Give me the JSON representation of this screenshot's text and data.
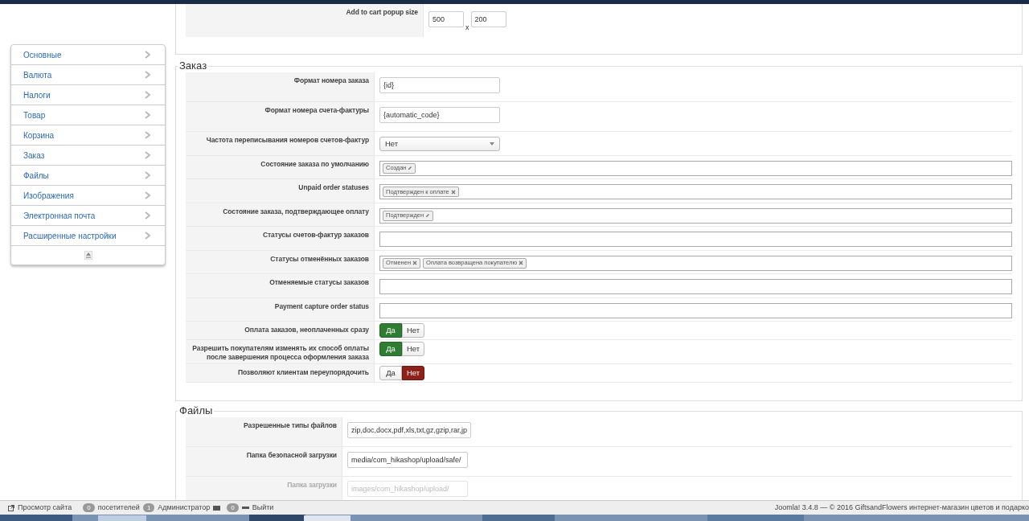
{
  "top_section": {
    "rows": [
      {
        "label": "Add to cart popup size",
        "kind": "size",
        "values": [
          "500",
          "200"
        ],
        "separator": "x"
      }
    ]
  },
  "sidebar": {
    "items": [
      {
        "label": "Основные"
      },
      {
        "label": "Валюта"
      },
      {
        "label": "Налоги"
      },
      {
        "label": "Товар"
      },
      {
        "label": "Корзина"
      },
      {
        "label": "Заказ"
      },
      {
        "label": "Файлы"
      },
      {
        "label": "Изображения"
      },
      {
        "label": "Электронная почта"
      },
      {
        "label": "Расширенные настройки"
      }
    ]
  },
  "sections": [
    {
      "title": "Заказ",
      "rows": [
        {
          "label": "Формат номера заказа",
          "kind": "text",
          "value": "{id}"
        },
        {
          "label": "Формат номера счета-фактуры",
          "kind": "text",
          "value": "{automatic_code}"
        },
        {
          "label": "Частота переписывания номеров счетов-фактур",
          "kind": "select",
          "value": "Нет"
        },
        {
          "label": "Состояние заказа по умолчанию",
          "kind": "tags",
          "tags": [
            {
              "label": "Создан",
              "kind": "editable"
            }
          ]
        },
        {
          "label": "Unpaid order statuses",
          "kind": "tags",
          "tags": [
            {
              "label": "Подтвержден к оплате",
              "kind": "removable"
            }
          ]
        },
        {
          "label": "Состояние заказа, подтверждающее оплату",
          "kind": "tags",
          "tags": [
            {
              "label": "Подтвержден",
              "kind": "editable"
            }
          ]
        },
        {
          "label": "Статусы счетов-фактур заказов",
          "kind": "tags",
          "tags": []
        },
        {
          "label": "Статусы отменённых заказов",
          "kind": "tags",
          "tags": [
            {
              "label": "Отменен",
              "kind": "removable"
            },
            {
              "label": "Оплата возвращена покупателю",
              "kind": "removable"
            }
          ]
        },
        {
          "label": "Отменяемые статусы заказов",
          "kind": "tags",
          "tags": []
        },
        {
          "label": "Payment capture order status",
          "kind": "tags",
          "tags": []
        },
        {
          "label": "Оплата заказов, неоплаченных сразу",
          "kind": "toggle",
          "options": [
            {
              "label": "Да",
              "kind": "yes",
              "selected": true
            },
            {
              "label": "Нет",
              "kind": "no",
              "selected": false
            }
          ]
        },
        {
          "label": "Разрешить покупателям изменять их способ оплаты после завершения процесса оформления заказа",
          "kind": "toggle",
          "options": [
            {
              "label": "Да",
              "kind": "yes",
              "selected": true
            },
            {
              "label": "Нет",
              "kind": "no",
              "selected": false
            }
          ]
        },
        {
          "label": "Позволяют клиентам переупорядочить",
          "kind": "toggle",
          "options": [
            {
              "label": "Да",
              "kind": "yes",
              "selected": false
            },
            {
              "label": "Нет",
              "kind": "no",
              "selected": true
            }
          ]
        }
      ]
    },
    {
      "title": "Файлы",
      "rows": [
        {
          "label": "Разрешенные типы файлов",
          "kind": "text",
          "value": "zip,doc,docx,pdf,xls,txt,gz,gzip,rar,jp",
          "disabled": false
        },
        {
          "label": "Папка безопасной загрузки",
          "kind": "text",
          "value": "media/com_hikashop/upload/safe/",
          "disabled": false
        },
        {
          "label": "Папка загрузки",
          "kind": "text",
          "value": "images/com_hikashop/upload/",
          "disabled": true
        }
      ]
    }
  ],
  "status_bar": {
    "items": [
      {
        "kind": "link",
        "label": "Просмотр сайта"
      },
      {
        "kind": "count",
        "count": "0",
        "label": "посетителей"
      },
      {
        "kind": "count",
        "count": "1",
        "label": "Администратор"
      },
      {
        "kind": "mail",
        "count": "0"
      },
      {
        "kind": "logout",
        "label": "Выйти"
      }
    ],
    "footer": "Joomla! 3.4.8 — © 2016 GiftsandFlowers интернет-магазин цветов и подарко"
  }
}
